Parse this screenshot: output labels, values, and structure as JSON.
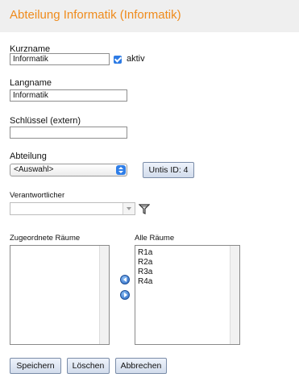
{
  "header": {
    "title": "Abteilung Informatik (Informatik)"
  },
  "form": {
    "kurzname_label": "Kurzname",
    "kurzname_value": "Informatik",
    "aktiv_label": "aktiv",
    "aktiv_checked": true,
    "langname_label": "Langname",
    "langname_value": "Informatik",
    "schluessel_label": "Schlüssel (extern)",
    "schluessel_value": "",
    "abteilung_label": "Abteilung",
    "abteilung_selected": "<Auswahl>",
    "untis_id_label": "Untis ID: 4",
    "verantwortlicher_label": "Verantwortlicher",
    "verantwortlicher_value": ""
  },
  "rooms": {
    "assigned_label": "Zugeordnete Räume",
    "assigned_items": [],
    "all_label": "Alle Räume",
    "all_items": [
      "R1a",
      "R2a",
      "R3a",
      "R4a"
    ]
  },
  "actions": {
    "save_label": "Speichern",
    "delete_label": "Löschen",
    "cancel_label": "Abbrechen"
  },
  "colors": {
    "title": "#ef8b1c",
    "header_bg": "#efefef",
    "accent_blue": "#2f7ee8"
  }
}
